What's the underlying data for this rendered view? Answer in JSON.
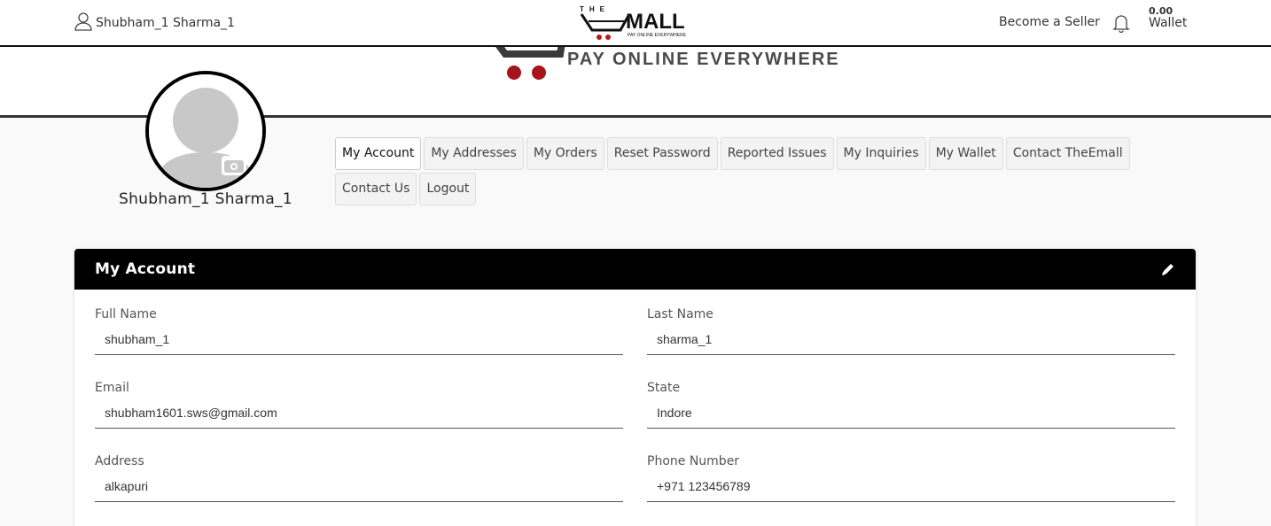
{
  "topbar": {
    "user_name": "Shubham_1 Sharma_1",
    "brand_top": "THE",
    "brand_name": "MALL",
    "brand_tagline": "PAY ONLINE EVERYWHERE",
    "become_seller": "Become a Seller",
    "wallet_amount": "0.00",
    "wallet_label": "Wallet"
  },
  "banner": {
    "tagline": "PAY ONLINE EVERYWHERE"
  },
  "profile": {
    "name": "Shubham_1 Sharma_1"
  },
  "tabs": [
    {
      "label": "My Account",
      "active": true
    },
    {
      "label": "My Addresses"
    },
    {
      "label": "My Orders"
    },
    {
      "label": "Reset Password"
    },
    {
      "label": "Reported Issues"
    },
    {
      "label": "My Inquiries"
    },
    {
      "label": "My Wallet"
    },
    {
      "label": "Contact TheEmall"
    },
    {
      "label": "Contact Us"
    },
    {
      "label": "Logout"
    }
  ],
  "account": {
    "title": "My Account",
    "fields": {
      "full_name": {
        "label": "Full Name",
        "value": "shubham_1"
      },
      "last_name": {
        "label": "Last Name",
        "value": "sharma_1"
      },
      "email": {
        "label": "Email",
        "value": "shubham1601.sws@gmail.com"
      },
      "state": {
        "label": "State",
        "value": "Indore"
      },
      "address": {
        "label": "Address",
        "value": "alkapuri"
      },
      "phone": {
        "label": "Phone Number",
        "value": "+971 123456789"
      }
    }
  },
  "colors": {
    "logo_red": "#c0141c",
    "header_black": "#000000",
    "page_bg": "#f9f9f9"
  },
  "icons": [
    "user-icon",
    "bell-icon",
    "camera-icon",
    "pencil-icon",
    "cart-logo-icon"
  ]
}
